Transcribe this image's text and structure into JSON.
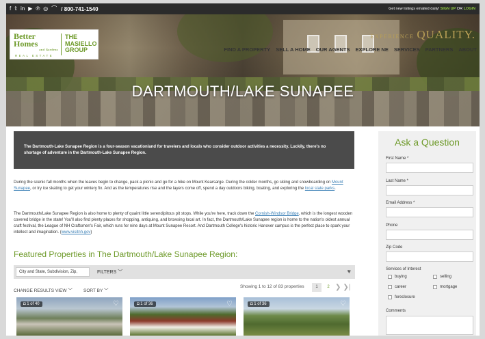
{
  "topbar": {
    "social_icons": [
      "facebook-icon",
      "twitter-icon",
      "linkedin-icon",
      "youtube-icon",
      "pinterest-icon",
      "instagram-icon",
      "rss-icon"
    ],
    "social_glyphs": [
      "f",
      "𝕥",
      "in",
      "▶",
      "℗",
      "◎",
      "⌒"
    ],
    "phone": "/ 800-741-1540",
    "promo": "Get new listings emailed daily!",
    "signup": "SIGN UP",
    "or": "OR",
    "login": "LOGIN"
  },
  "logo": {
    "line1": "Better",
    "line2": "Homes",
    "sub": "and Gardens",
    "real_estate": "REAL ESTATE",
    "group1": "THE",
    "group2": "MASIELLO",
    "group3": "GROUP"
  },
  "tagline": {
    "experience": "EXPERIENCE",
    "quality": "QUALITY."
  },
  "nav": [
    "FIND A PROPERTY",
    "SELL A HOME",
    "OUR AGENTS",
    "EXPLORE NE",
    "SERVICES",
    "PARTNERS",
    "ABOUT"
  ],
  "hero_title": "DARTMOUTH/LAKE SUNAPEE",
  "intro": "The Dartmouth-Lake Sunapee Region is a four-season vacationland for travelers and locals who consider outdoor activities a necessity. Luckily, there's no shortage of adventure in the Dartmouth-Lake Sunapee Region.",
  "para1": {
    "a": "During the scenic fall months when the leaves begin to change, pack a picnic and go for a hike on Mount Kearsarge. During the colder months, go skiing and snowboarding on ",
    "link1": "Mount Sunapee",
    "b": ", or try ice skating to get your wintery fix. And as the temperatures rise and the layers come off, spend a day outdoors biking, boating, and exploring the ",
    "link2": "local state parks",
    "c": "."
  },
  "para2": {
    "a": "The Dartmouth/Lake Sunapee Region is also home to plenty of quaint little serendipitous pit stops. While you're here, track down the ",
    "link1": "Cornish-Windsor Bridge",
    "b": ", which is the longest wooden covered bridge in the state! You'll also find plenty places for shopping, antiquing, and browsing local art. In fact, the Dartmouth/Lake Sunapee region is home to the nation's oldest annual craft festival, the League of NH Craftsmen's Fair, which runs for nine days at Mount Sunapee Resort. And Dartmouth College's historic Hanover campus is the perfect place to spark your intellect and imagination. (",
    "link2": "www.visitnh.gov",
    "c": ")"
  },
  "featured_title": "Featured Properties in The Dartmouth/Lake Sunapee Region:",
  "search": {
    "placeholder": "City and State, Subdivision, Zip,",
    "filters": "FILTERS ﹀"
  },
  "results": {
    "change_view": "CHANGE RESULTS VIEW  ﹀",
    "sort_by": "SORT BY  ﹀",
    "showing": "Showing 1 to 12 of 83 properties",
    "pages": [
      "1",
      "2"
    ]
  },
  "cards": [
    {
      "badge": "◘ 1 of 40"
    },
    {
      "badge": "◘ 1 of 36"
    },
    {
      "badge": "◘ 1 of 36"
    }
  ],
  "form": {
    "title": "Ask a Question",
    "first_name": "First Name *",
    "last_name": "Last Name *",
    "email": "Email Address *",
    "phone": "Phone",
    "zip": "Zip Code",
    "services": "Services of Interest",
    "options": [
      "buying",
      "selling",
      "career",
      "mortgage",
      "foreclosure"
    ],
    "comments": "Comments"
  }
}
